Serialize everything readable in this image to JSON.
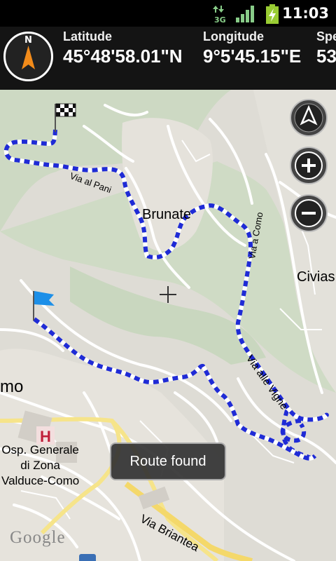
{
  "status_bar": {
    "time": "11:03",
    "network": "3G"
  },
  "info_bar": {
    "compass_letter": "N",
    "latitude_label": "Latitude",
    "latitude_value": "45°48'58.01\"N",
    "longitude_label": "Longitude",
    "longitude_value": "9°5'45.15\"E",
    "speed_label": "Spe",
    "speed_value": "53"
  },
  "map": {
    "labels": {
      "brunate": "Brunate",
      "civias": "Civias",
      "como": "mo",
      "via_alle_vigne": "Via alle Vigne",
      "via_briantea": "Via Briantea",
      "via_pani": "Via al Pani",
      "via_como": "Via a Como",
      "hospital_line1": "Osp. Generale",
      "hospital_line2": "di Zona",
      "hospital_line3": "Valduce-Como",
      "hospital_icon": "H",
      "google": "Google"
    },
    "route_color": "#1f2bd6",
    "toast": "Route found"
  }
}
